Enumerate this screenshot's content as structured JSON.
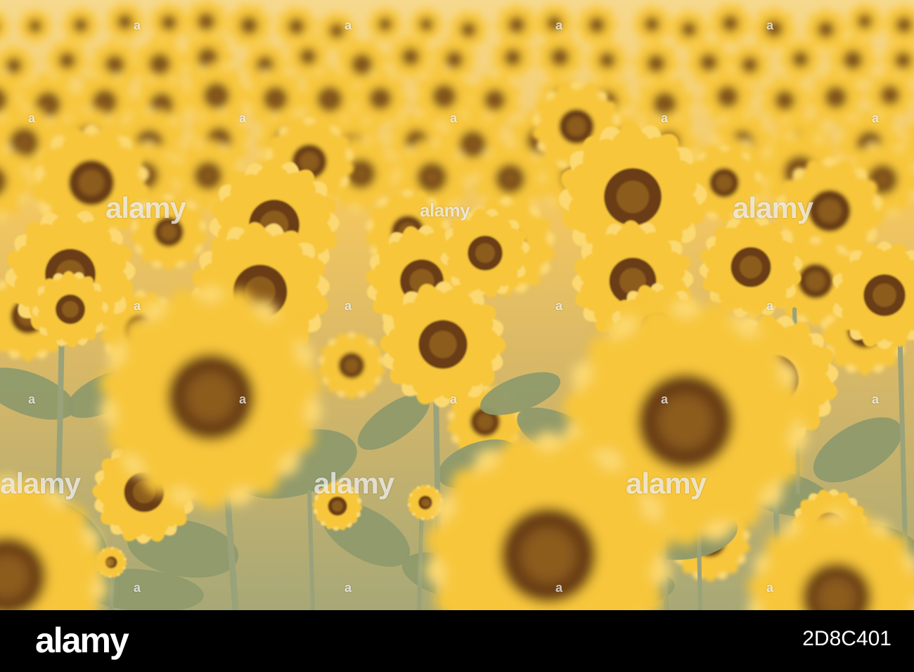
{
  "photo": {
    "subject": "sunflower-field",
    "colors": {
      "background": "#f0c65a",
      "petal": "#f7c63a",
      "petal_light": "#fbd870",
      "center": "#6a3e18",
      "center_inner": "#9a6a1e",
      "leaf": "#8f9a6c",
      "stem": "#9aa27a"
    }
  },
  "watermarks": {
    "brand": "alamy",
    "mark": "a"
  },
  "footer": {
    "logo": "alamy",
    "image_id": "2D8C401"
  }
}
